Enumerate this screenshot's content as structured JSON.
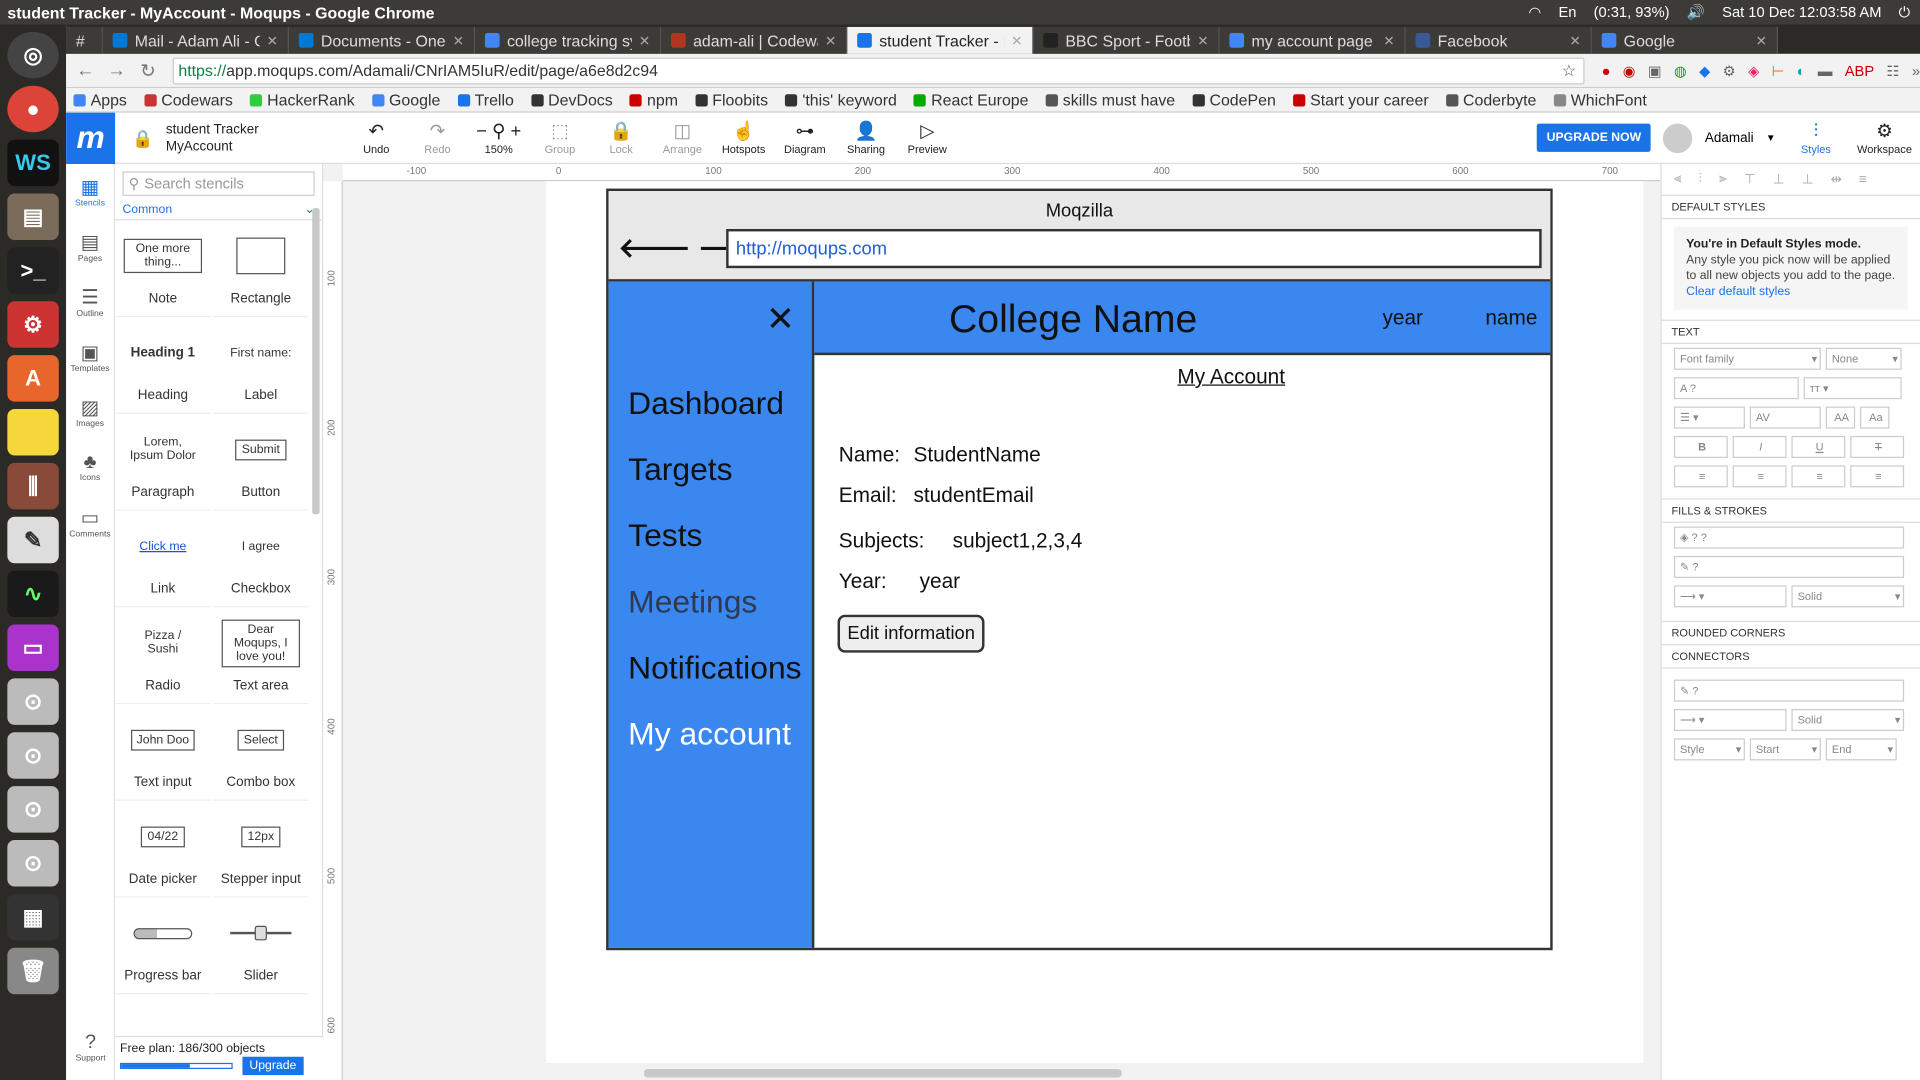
{
  "os": {
    "window_title": "student Tracker - MyAccount - Moqups - Google Chrome",
    "status": "(0:31, 93%)",
    "datetime": "Sat 10 Dec 12:03:58 AM"
  },
  "chrome": {
    "tabs": [
      {
        "label": "#",
        "color": "#555"
      },
      {
        "label": "Mail - Adam Ali - Ou",
        "color": "#0078d4"
      },
      {
        "label": "Documents - OneD",
        "color": "#0078d4"
      },
      {
        "label": "college tracking sy",
        "color": "#4285f4"
      },
      {
        "label": "adam-ali | Codewar",
        "color": "#b1361e"
      },
      {
        "label": "student Tracker - M",
        "color": "#1a73e8"
      },
      {
        "label": "BBC Sport - Footb",
        "color": "#222"
      },
      {
        "label": "my account page -",
        "color": "#4285f4"
      },
      {
        "label": "Facebook",
        "color": "#3b5998"
      },
      {
        "label": "Google",
        "color": "#4285f4"
      }
    ],
    "url_https": "https://",
    "url_rest": "app.moqups.com/Adamali/CNrIAM5IuR/edit/page/a6e8d2c94",
    "bookmarks": [
      "Apps",
      "Codewars",
      "HackerRank",
      "Google",
      "Trello",
      "DevDocs",
      "npm",
      "Floobits",
      "'this' keyword",
      "React Europe",
      "skills must have",
      "CodePen",
      "Start your career",
      "Coderbyte",
      "WhichFont"
    ]
  },
  "moqups": {
    "doc_title": "student Tracker",
    "page_name": "MyAccount",
    "tools": [
      {
        "icon": "↶",
        "label": "Undo",
        "disabled": false
      },
      {
        "icon": "↷",
        "label": "Redo",
        "disabled": true
      },
      {
        "icon": "− ⚲ +",
        "label": "150%",
        "disabled": false
      },
      {
        "icon": "⬚",
        "label": "Group",
        "disabled": true
      },
      {
        "icon": "🔒",
        "label": "Lock",
        "disabled": true
      },
      {
        "icon": "◫",
        "label": "Arrange",
        "disabled": true
      },
      {
        "icon": "☝",
        "label": "Hotspots",
        "disabled": false
      },
      {
        "icon": "⊶",
        "label": "Diagram",
        "disabled": false
      },
      {
        "icon": "👤",
        "label": "Sharing",
        "disabled": false
      },
      {
        "icon": "▷",
        "label": "Preview",
        "disabled": false
      }
    ],
    "upgrade_label": "UPGRADE NOW",
    "user": "Adamali",
    "right_tools": [
      "Styles",
      "Workspace"
    ]
  },
  "rail": [
    "Stencils",
    "Pages",
    "Outline",
    "Templates",
    "Images",
    "Icons",
    "Comments"
  ],
  "support_label": "Support",
  "stencils": {
    "search_placeholder": "Search stencils",
    "category": "Common",
    "items": [
      {
        "label": "Note",
        "preview": "One more thing..."
      },
      {
        "label": "Rectangle",
        "preview": ""
      },
      {
        "label": "Heading",
        "preview": "Heading 1"
      },
      {
        "label": "Label",
        "preview": "First name:"
      },
      {
        "label": "Paragraph",
        "preview": "Lorem, Ipsum Dolor"
      },
      {
        "label": "Button",
        "preview": "Submit"
      },
      {
        "label": "Link",
        "preview": "Click me"
      },
      {
        "label": "Checkbox",
        "preview": "I agree"
      },
      {
        "label": "Radio",
        "preview": "Pizza / Sushi"
      },
      {
        "label": "Text area",
        "preview": "Dear Moqups, I love you!"
      },
      {
        "label": "Text input",
        "preview": "John Doo"
      },
      {
        "label": "Combo box",
        "preview": "Select"
      },
      {
        "label": "Date picker",
        "preview": "04/22"
      },
      {
        "label": "Stepper input",
        "preview": "12px"
      },
      {
        "label": "Progress bar",
        "preview": ""
      },
      {
        "label": "Slider",
        "preview": ""
      }
    ],
    "plan_text": "Free plan: 186/300 objects",
    "plan_fraction": 0.62,
    "upgrade": "Upgrade"
  },
  "ruler": {
    "h": [
      "-100",
      "0",
      "100",
      "200",
      "300",
      "400",
      "500",
      "600",
      "700"
    ],
    "v": [
      "100",
      "200",
      "300",
      "400",
      "500",
      "600"
    ]
  },
  "mockup": {
    "browser_title": "Moqzilla",
    "url": "http://moqups.com",
    "menu": [
      "Dashboard",
      "Targets",
      "Tests",
      "Meetings",
      "Notifications",
      "My account"
    ],
    "college": "College Name",
    "year": "year",
    "name": "name",
    "account_title": "My Account",
    "fields": [
      {
        "label": "Name:",
        "value": "StudentName"
      },
      {
        "label": "Email:",
        "value": "studentEmail"
      },
      {
        "label": "Subjects:",
        "value": "subject1,2,3,4"
      },
      {
        "label": "Year:",
        "value": "year"
      }
    ],
    "edit_button": "Edit information",
    "colors": {
      "accent": "#3b87f0"
    }
  },
  "rpanel": {
    "default_styles": "DEFAULT STYLES",
    "mode_title": "You're in Default Styles mode.",
    "mode_text": "Any style you pick now will be applied to all new objects you add to the page.",
    "clear_link": "Clear default styles",
    "text": "TEXT",
    "font_family": "Font family",
    "none": "None",
    "fills": "FILLS & STROKES",
    "solid": "Solid",
    "rounded": "ROUNDED CORNERS",
    "connectors": "CONNECTORS",
    "style": "Style",
    "start": "Start",
    "end": "End"
  }
}
